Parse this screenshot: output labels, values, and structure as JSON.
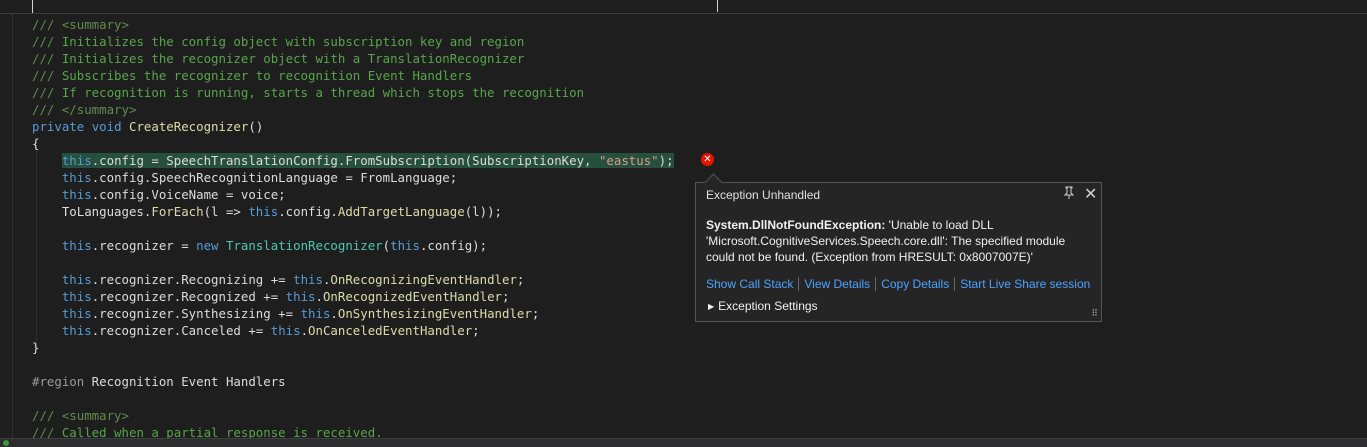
{
  "editor": {
    "lines": [
      {
        "tokens": [
          {
            "c": "tg",
            "t": "/// "
          },
          {
            "c": "tg",
            "t": "<summary>"
          }
        ]
      },
      {
        "tokens": [
          {
            "c": "tg",
            "t": "/// "
          },
          {
            "c": "cm",
            "t": "Initializes the config object with subscription key and region"
          }
        ]
      },
      {
        "tokens": [
          {
            "c": "tg",
            "t": "/// "
          },
          {
            "c": "cm",
            "t": "Initializes the recognizer object with a TranslationRecognizer"
          }
        ]
      },
      {
        "tokens": [
          {
            "c": "tg",
            "t": "/// "
          },
          {
            "c": "cm",
            "t": "Subscribes the recognizer to recognition Event Handlers"
          }
        ]
      },
      {
        "tokens": [
          {
            "c": "tg",
            "t": "/// "
          },
          {
            "c": "cm",
            "t": "If recognition is running, starts a thread which stops the recognition"
          }
        ]
      },
      {
        "tokens": [
          {
            "c": "tg",
            "t": "/// "
          },
          {
            "c": "tg",
            "t": "</summary>"
          }
        ]
      },
      {
        "tokens": [
          {
            "c": "kw",
            "t": "private"
          },
          {
            "c": "",
            "t": " "
          },
          {
            "c": "kw",
            "t": "void"
          },
          {
            "c": "",
            "t": " "
          },
          {
            "c": "fn",
            "t": "CreateRecognizer"
          },
          {
            "c": "",
            "t": "()"
          }
        ]
      },
      {
        "tokens": [
          {
            "c": "",
            "t": "{"
          }
        ]
      },
      {
        "tokens": [
          {
            "c": "",
            "t": "    "
          },
          {
            "c": "kw hl",
            "t": "this"
          },
          {
            "c": "hl",
            "t": ".config = SpeechTranslationConfig.FromSubscription(SubscriptionKey, "
          },
          {
            "c": "st hl",
            "t": "\"eastus\""
          },
          {
            "c": "hl",
            "t": ");"
          }
        ]
      },
      {
        "tokens": [
          {
            "c": "",
            "t": "    "
          },
          {
            "c": "kw",
            "t": "this"
          },
          {
            "c": "",
            "t": ".config.SpeechRecognitionLanguage = FromLanguage;"
          }
        ]
      },
      {
        "tokens": [
          {
            "c": "",
            "t": "    "
          },
          {
            "c": "kw",
            "t": "this"
          },
          {
            "c": "",
            "t": ".config.VoiceName = voice;"
          }
        ]
      },
      {
        "tokens": [
          {
            "c": "",
            "t": "    ToLanguages."
          },
          {
            "c": "fn",
            "t": "ForEach"
          },
          {
            "c": "",
            "t": "(l => "
          },
          {
            "c": "kw",
            "t": "this"
          },
          {
            "c": "",
            "t": ".config."
          },
          {
            "c": "fn",
            "t": "AddTargetLanguage"
          },
          {
            "c": "",
            "t": "(l));"
          }
        ]
      },
      {
        "tokens": []
      },
      {
        "tokens": [
          {
            "c": "",
            "t": "    "
          },
          {
            "c": "kw",
            "t": "this"
          },
          {
            "c": "",
            "t": ".recognizer = "
          },
          {
            "c": "kw",
            "t": "new"
          },
          {
            "c": "",
            "t": " "
          },
          {
            "c": "ty",
            "t": "TranslationRecognizer"
          },
          {
            "c": "",
            "t": "("
          },
          {
            "c": "kw",
            "t": "this"
          },
          {
            "c": "",
            "t": ".config);"
          }
        ]
      },
      {
        "tokens": []
      },
      {
        "tokens": [
          {
            "c": "",
            "t": "    "
          },
          {
            "c": "kw",
            "t": "this"
          },
          {
            "c": "",
            "t": ".recognizer.Recognizing += "
          },
          {
            "c": "kw",
            "t": "this"
          },
          {
            "c": "",
            "t": "."
          },
          {
            "c": "fn",
            "t": "OnRecognizingEventHandler"
          },
          {
            "c": "",
            "t": ";"
          }
        ]
      },
      {
        "tokens": [
          {
            "c": "",
            "t": "    "
          },
          {
            "c": "kw",
            "t": "this"
          },
          {
            "c": "",
            "t": ".recognizer.Recognized += "
          },
          {
            "c": "kw",
            "t": "this"
          },
          {
            "c": "",
            "t": "."
          },
          {
            "c": "fn",
            "t": "OnRecognizedEventHandler"
          },
          {
            "c": "",
            "t": ";"
          }
        ]
      },
      {
        "tokens": [
          {
            "c": "",
            "t": "    "
          },
          {
            "c": "kw",
            "t": "this"
          },
          {
            "c": "",
            "t": ".recognizer.Synthesizing += "
          },
          {
            "c": "kw",
            "t": "this"
          },
          {
            "c": "",
            "t": "."
          },
          {
            "c": "fn",
            "t": "OnSynthesizingEventHandler"
          },
          {
            "c": "",
            "t": ";"
          }
        ]
      },
      {
        "tokens": [
          {
            "c": "",
            "t": "    "
          },
          {
            "c": "kw",
            "t": "this"
          },
          {
            "c": "",
            "t": ".recognizer.Canceled += "
          },
          {
            "c": "kw",
            "t": "this"
          },
          {
            "c": "",
            "t": "."
          },
          {
            "c": "fn",
            "t": "OnCanceledEventHandler"
          },
          {
            "c": "",
            "t": ";"
          }
        ]
      },
      {
        "tokens": [
          {
            "c": "",
            "t": "}"
          }
        ]
      },
      {
        "tokens": []
      },
      {
        "tokens": [
          {
            "c": "rg",
            "t": "#region"
          },
          {
            "c": "",
            "t": " Recognition Event Handlers"
          }
        ]
      },
      {
        "tokens": []
      },
      {
        "tokens": [
          {
            "c": "tg",
            "t": "/// "
          },
          {
            "c": "tg",
            "t": "<summary>"
          }
        ]
      },
      {
        "tokens": [
          {
            "c": "tg",
            "t": "/// "
          },
          {
            "c": "cm",
            "t": "Called when a partial response is received."
          }
        ]
      }
    ]
  },
  "exception_popup": {
    "title": "Exception Unhandled",
    "exception_type": "System.DllNotFoundException:",
    "message": " 'Unable to load DLL 'Microsoft.CognitiveServices.Speech.core.dll': The specified module could not be found. (Exception from HRESULT: 0x8007007E)'",
    "links": {
      "call_stack": "Show Call Stack",
      "view_details": "View Details",
      "copy_details": "Copy Details",
      "live_share": "Start Live Share session"
    },
    "exception_settings": "Exception Settings",
    "icons": {
      "pin": "pin-icon",
      "close": "close-icon",
      "error": "error-icon",
      "expand": "chevron-right-icon"
    }
  },
  "colors": {
    "background": "#1e1e1e",
    "keyword": "#569cd6",
    "type": "#4ec9b0",
    "method": "#dcdcaa",
    "string": "#d69d85",
    "comment": "#57a64a",
    "error": "#e51400",
    "link": "#4da3ff"
  }
}
